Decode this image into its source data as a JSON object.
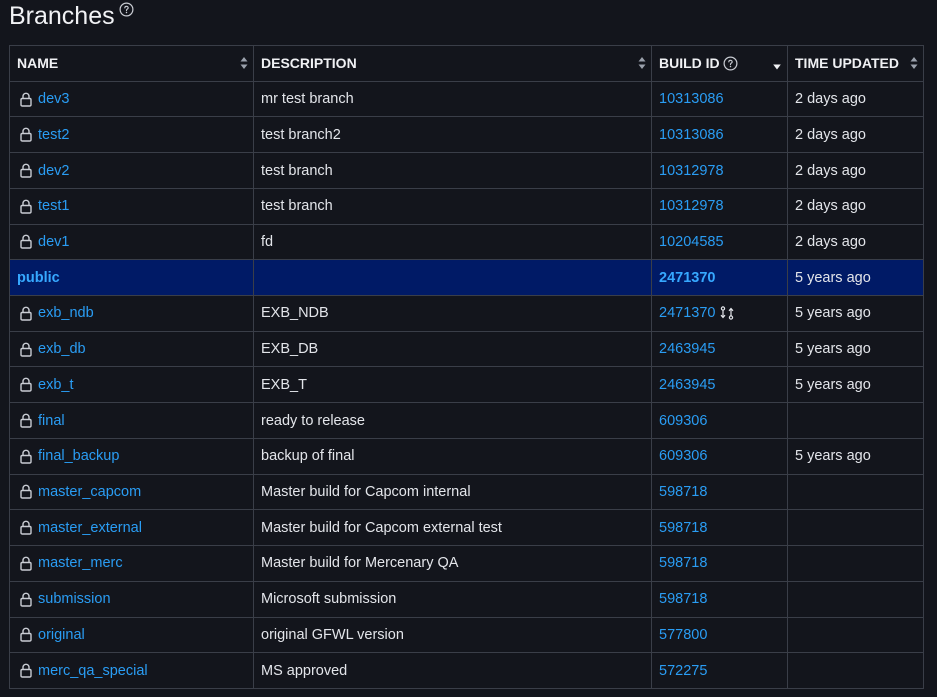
{
  "page": {
    "title": "Branches"
  },
  "table": {
    "columns": {
      "name": "NAME",
      "description": "DESCRIPTION",
      "build_id": "BUILD ID",
      "time_updated": "TIME UPDATED"
    },
    "rows": [
      {
        "name": "dev3",
        "locked": true,
        "description": "mr test branch",
        "build_id": "10313086",
        "time_updated": "2 days ago"
      },
      {
        "name": "test2",
        "locked": true,
        "description": "test branch2",
        "build_id": "10313086",
        "time_updated": "2 days ago"
      },
      {
        "name": "dev2",
        "locked": true,
        "description": "test branch",
        "build_id": "10312978",
        "time_updated": "2 days ago"
      },
      {
        "name": "test1",
        "locked": true,
        "description": "test branch",
        "build_id": "10312978",
        "time_updated": "2 days ago"
      },
      {
        "name": "dev1",
        "locked": true,
        "description": "fd",
        "build_id": "10204585",
        "time_updated": "2 days ago"
      },
      {
        "name": "public",
        "locked": false,
        "highlighted": true,
        "description": "",
        "build_id": "2471370",
        "time_updated": "5 years ago"
      },
      {
        "name": "exb_ndb",
        "locked": true,
        "description": "EXB_NDB",
        "build_id": "2471370",
        "time_updated": "5 years ago",
        "build_icon": "transfer-icon"
      },
      {
        "name": "exb_db",
        "locked": true,
        "description": "EXB_DB",
        "build_id": "2463945",
        "time_updated": "5 years ago"
      },
      {
        "name": "exb_t",
        "locked": true,
        "description": "EXB_T",
        "build_id": "2463945",
        "time_updated": "5 years ago"
      },
      {
        "name": "final",
        "locked": true,
        "description": "ready to release",
        "build_id": "609306",
        "time_updated": ""
      },
      {
        "name": "final_backup",
        "locked": true,
        "description": "backup of final",
        "build_id": "609306",
        "time_updated": "5 years ago"
      },
      {
        "name": "master_capcom",
        "locked": true,
        "description": "Master build for Capcom internal",
        "build_id": "598718",
        "time_updated": ""
      },
      {
        "name": "master_external",
        "locked": true,
        "description": "Master build for Capcom external test",
        "build_id": "598718",
        "time_updated": ""
      },
      {
        "name": "master_merc",
        "locked": true,
        "description": "Master build for Mercenary QA",
        "build_id": "598718",
        "time_updated": ""
      },
      {
        "name": "submission",
        "locked": true,
        "description": "Microsoft submission",
        "build_id": "598718",
        "time_updated": ""
      },
      {
        "name": "original",
        "locked": true,
        "description": "original GFWL version",
        "build_id": "577800",
        "time_updated": ""
      },
      {
        "name": "merc_qa_special",
        "locked": true,
        "description": "MS approved",
        "build_id": "572275",
        "time_updated": ""
      }
    ]
  },
  "colors": {
    "background": "#13151c",
    "link": "#2a9df4",
    "highlight_row": "#001a66",
    "border": "#3a3e48",
    "text": "#e3e5ea"
  }
}
